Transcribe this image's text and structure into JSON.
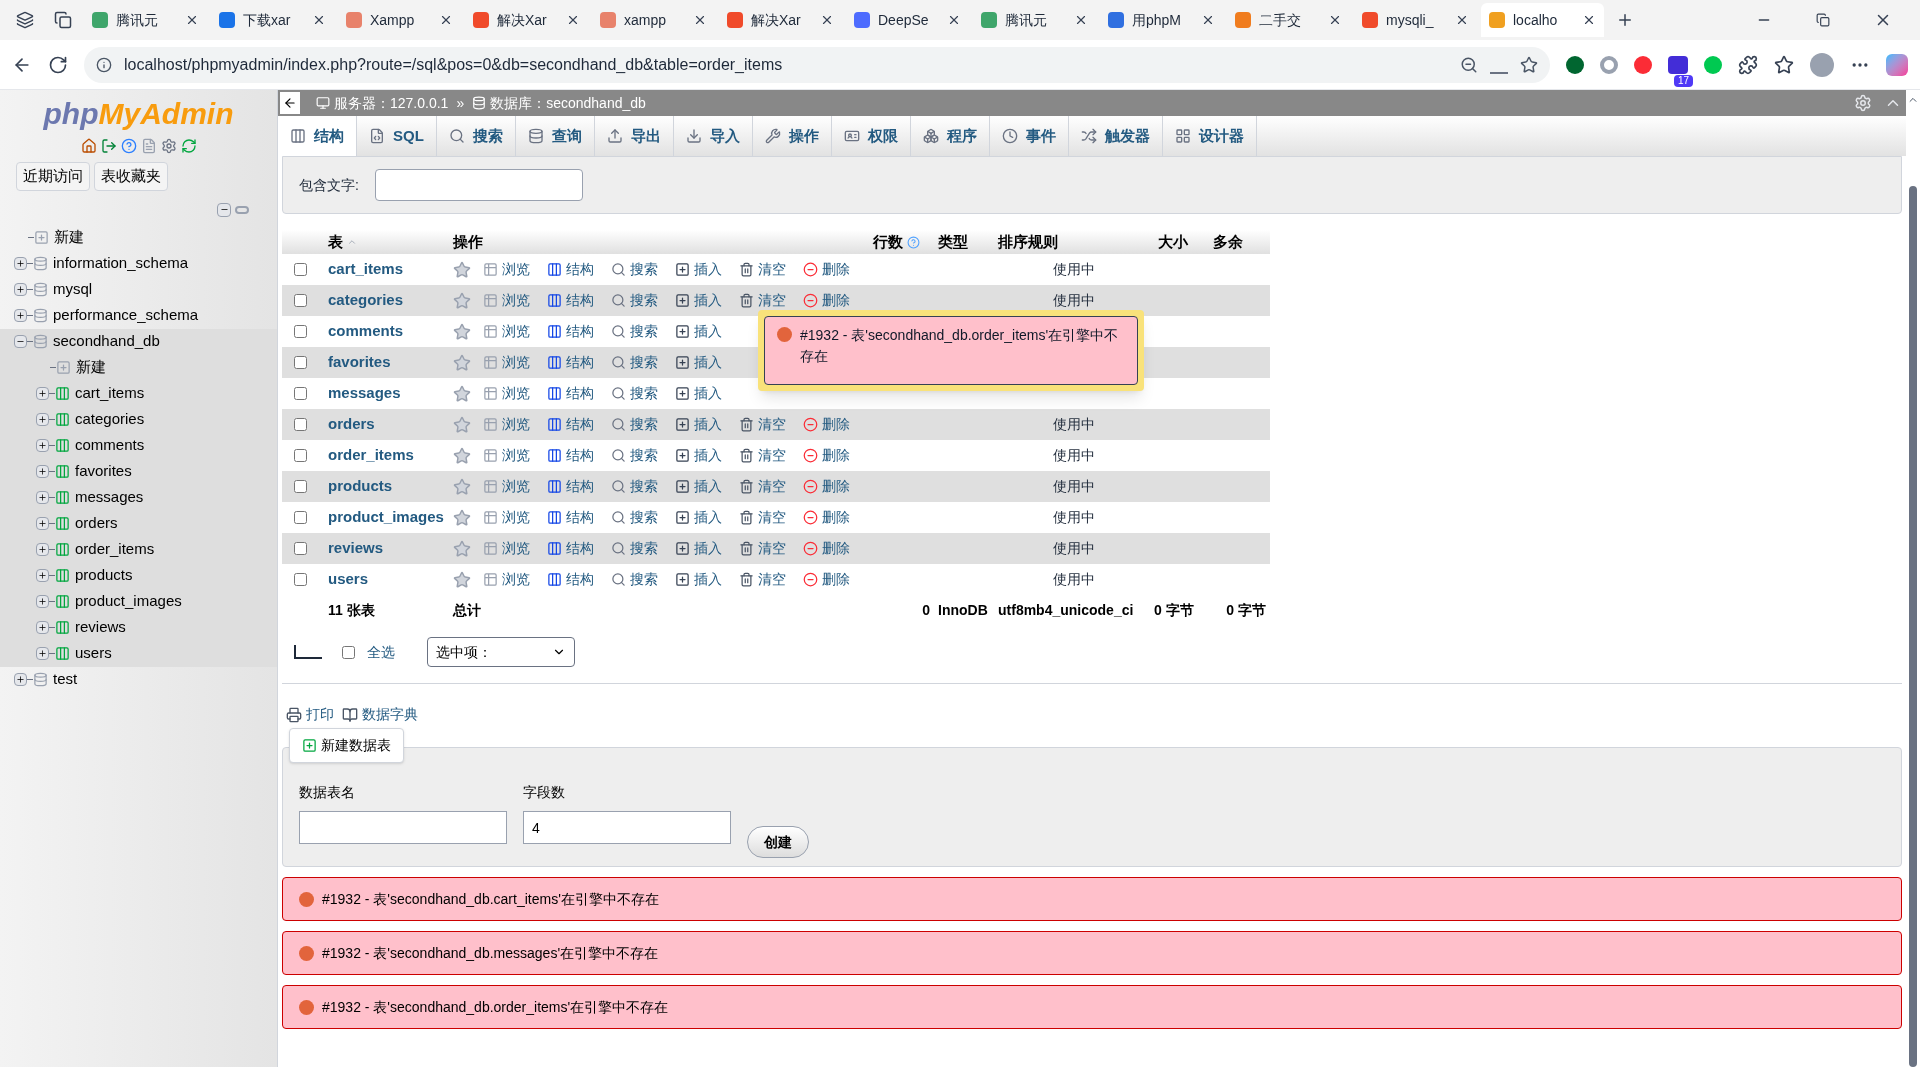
{
  "browser": {
    "tabs": [
      {
        "title": "腾讯元",
        "color": "#3fa66b",
        "selected": false
      },
      {
        "title": "下载xar",
        "color": "#1a73e8",
        "selected": false
      },
      {
        "title": "Xampp",
        "color": "#e8826b",
        "selected": false
      },
      {
        "title": "解决Xar",
        "color": "#f04a2a",
        "selected": false
      },
      {
        "title": "xampp",
        "color": "#e8826b",
        "selected": false
      },
      {
        "title": "解决Xar",
        "color": "#f04a2a",
        "selected": false
      },
      {
        "title": "DeepSe",
        "color": "#4d6bfe",
        "selected": false
      },
      {
        "title": "腾讯元",
        "color": "#3fa66b",
        "selected": false
      },
      {
        "title": "用phpM",
        "color": "#2f6fe0",
        "selected": false
      },
      {
        "title": "二手交",
        "color": "#f07c1e",
        "selected": false
      },
      {
        "title": "mysqli_",
        "color": "#f04a2a",
        "selected": false
      },
      {
        "title": "localho",
        "color": "#f0a020",
        "selected": true
      }
    ],
    "address": "localhost/phpmyadmin/index.php?route=/sql&pos=0&db=secondhand_db&table=order_items",
    "badge": "17"
  },
  "sidebar": {
    "logo": {
      "first": "php",
      "second": "MyAdmin"
    },
    "buttons": [
      "近期访问",
      "表收藏夹"
    ],
    "tree": [
      {
        "label": "新建",
        "kind": "new"
      },
      {
        "label": "information_schema",
        "kind": "db",
        "expanded": false
      },
      {
        "label": "mysql",
        "kind": "db",
        "expanded": false
      },
      {
        "label": "performance_schema",
        "kind": "db",
        "expanded": false
      },
      {
        "label": "secondhand_db",
        "kind": "db",
        "expanded": true,
        "children": [
          {
            "label": "新建",
            "kind": "new"
          },
          {
            "label": "cart_items",
            "kind": "table",
            "expanded": false
          },
          {
            "label": "categories",
            "kind": "table",
            "expanded": false
          },
          {
            "label": "comments",
            "kind": "table",
            "expanded": false
          },
          {
            "label": "favorites",
            "kind": "table",
            "expanded": false
          },
          {
            "label": "messages",
            "kind": "table",
            "expanded": false
          },
          {
            "label": "orders",
            "kind": "table",
            "expanded": false
          },
          {
            "label": "order_items",
            "kind": "table",
            "expanded": false
          },
          {
            "label": "products",
            "kind": "table",
            "expanded": false
          },
          {
            "label": "product_images",
            "kind": "table",
            "expanded": false
          },
          {
            "label": "reviews",
            "kind": "table",
            "expanded": false
          },
          {
            "label": "users",
            "kind": "table",
            "expanded": false
          }
        ]
      },
      {
        "label": "test",
        "kind": "db",
        "expanded": false
      }
    ]
  },
  "breadcrumb": {
    "server_label": "服务器：",
    "server": "127.0.0.1",
    "separator": "»",
    "db_label": "数据库：",
    "db": "secondhand_db"
  },
  "menu_tabs": [
    {
      "label": "结构",
      "selected": true
    },
    {
      "label": "SQL",
      "selected": false
    },
    {
      "label": "搜索",
      "selected": false
    },
    {
      "label": "查询",
      "selected": false
    },
    {
      "label": "导出",
      "selected": false
    },
    {
      "label": "导入",
      "selected": false
    },
    {
      "label": "操作",
      "selected": false
    },
    {
      "label": "权限",
      "selected": false
    },
    {
      "label": "程序",
      "selected": false
    },
    {
      "label": "事件",
      "selected": false
    },
    {
      "label": "触发器",
      "selected": false
    },
    {
      "label": "设计器",
      "selected": false
    }
  ],
  "filter": {
    "label": "包含文字:"
  },
  "table": {
    "columns": [
      "表",
      "操作",
      "行数",
      "类型",
      "排序规则",
      "大小",
      "多余"
    ],
    "rows": [
      {
        "name": "cart_items",
        "checked": false,
        "actions": [
          "浏览",
          "结构",
          "搜索",
          "插入",
          "清空",
          "删除"
        ],
        "status": "使用中"
      },
      {
        "name": "categories",
        "checked": false,
        "actions": [
          "浏览",
          "结构",
          "搜索",
          "插入",
          "清空",
          "删除"
        ],
        "status": "使用中"
      },
      {
        "name": "comments",
        "checked": false,
        "actions": [
          "浏览",
          "结构",
          "搜索",
          "插入"
        ]
      },
      {
        "name": "favorites",
        "checked": false,
        "actions": [
          "浏览",
          "结构",
          "搜索",
          "插入"
        ]
      },
      {
        "name": "messages",
        "checked": false,
        "actions": [
          "浏览",
          "结构",
          "搜索",
          "插入"
        ]
      },
      {
        "name": "orders",
        "checked": false,
        "actions": [
          "浏览",
          "结构",
          "搜索",
          "插入",
          "清空",
          "删除"
        ],
        "status": "使用中"
      },
      {
        "name": "order_items",
        "checked": false,
        "actions": [
          "浏览",
          "结构",
          "搜索",
          "插入",
          "清空",
          "删除"
        ],
        "status": "使用中"
      },
      {
        "name": "products",
        "checked": false,
        "actions": [
          "浏览",
          "结构",
          "搜索",
          "插入",
          "清空",
          "删除"
        ],
        "status": "使用中"
      },
      {
        "name": "product_images",
        "checked": false,
        "actions": [
          "浏览",
          "结构",
          "搜索",
          "插入",
          "清空",
          "删除"
        ],
        "status": "使用中"
      },
      {
        "name": "reviews",
        "checked": false,
        "actions": [
          "浏览",
          "结构",
          "搜索",
          "插入",
          "清空",
          "删除"
        ],
        "status": "使用中"
      },
      {
        "name": "users",
        "checked": false,
        "actions": [
          "浏览",
          "结构",
          "搜索",
          "插入",
          "清空",
          "删除"
        ],
        "status": "使用中"
      }
    ],
    "footer": {
      "count": "11 张表",
      "label": "总计",
      "rows": "0",
      "type": "InnoDB",
      "collation": "utf8mb4_unicode_ci",
      "size": "0 字节",
      "overhead": "0 字节"
    }
  },
  "bulk": {
    "select_all": "全选",
    "checked": false,
    "dropdown": "选中项："
  },
  "links": [
    "打印",
    "数据字典"
  ],
  "create": {
    "title": "新建数据表",
    "name_label": "数据表名",
    "fields_label": "字段数",
    "fields_value": "4",
    "button": "创建"
  },
  "popup": "#1932 - 表'secondhand_db.order_items'在引擎中不存在",
  "errors": [
    "#1932 - 表'secondhand_db.cart_items'在引擎中不存在",
    "#1932 - 表'secondhand_db.messages'在引擎中不存在",
    "#1932 - 表'secondhand_db.order_items'在引擎中不存在"
  ]
}
